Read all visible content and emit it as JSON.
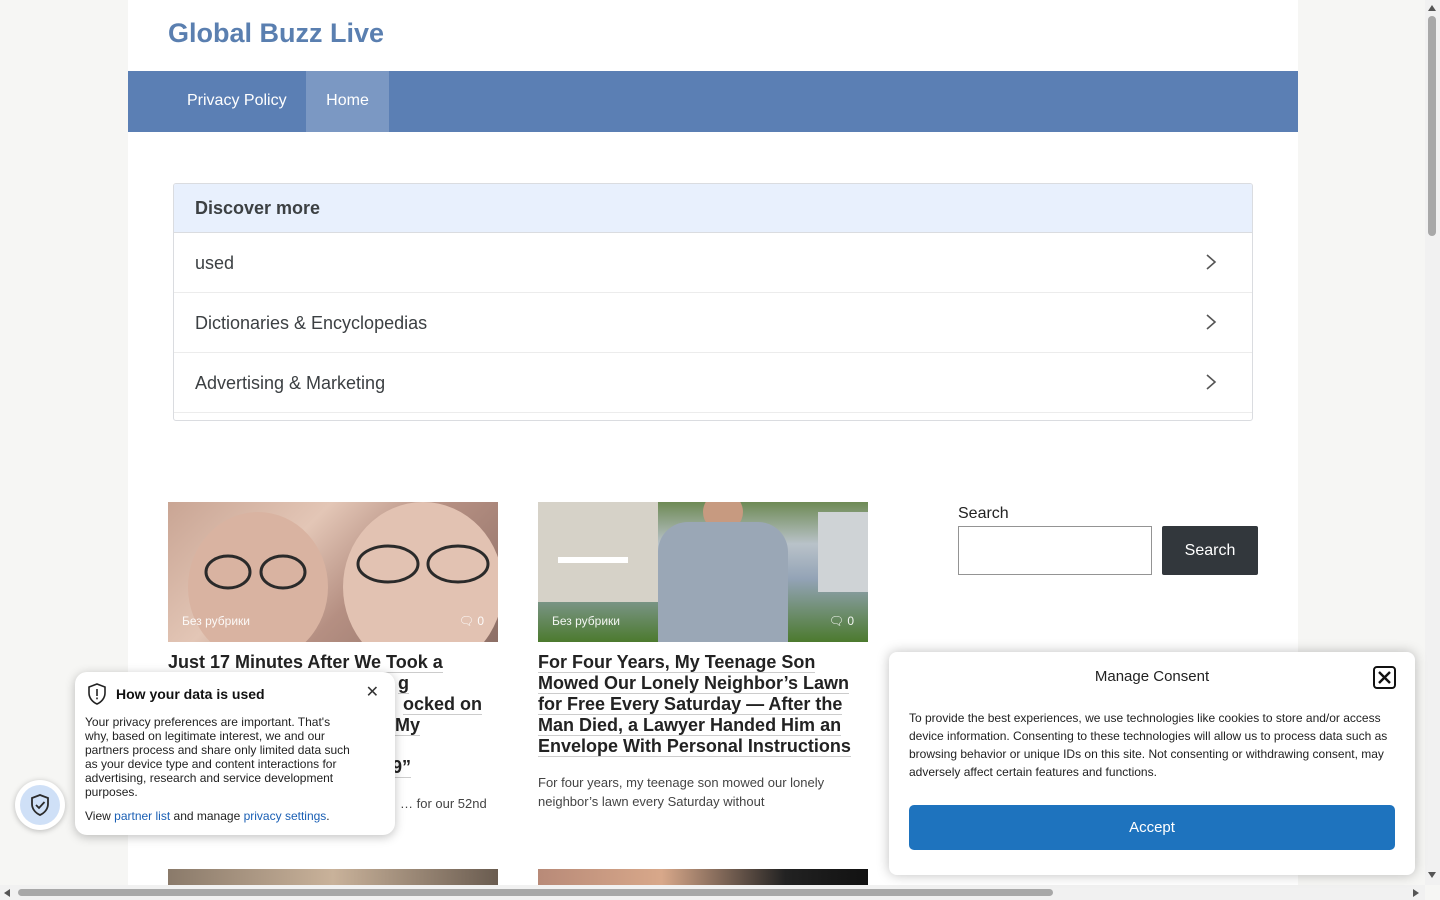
{
  "site": {
    "title": "Global Buzz Live"
  },
  "nav": {
    "items": [
      {
        "label": "Privacy Policy"
      },
      {
        "label": "Home"
      }
    ]
  },
  "discover": {
    "heading": "Discover more",
    "items": [
      {
        "label": "used"
      },
      {
        "label": "Dictionaries & Encyclopedias"
      },
      {
        "label": "Advertising & Marketing"
      }
    ]
  },
  "posts": [
    {
      "category": "Без рубрики",
      "comments": "0",
      "title": "Just 17 Minutes After We Took a … g … ocked on … My Husband … 9”",
      "excerpt": "… for our 52nd"
    },
    {
      "category": "Без рубрики",
      "comments": "0",
      "title": "For Four Years, My Teenage Son Mowed Our Lonely Neighbor’s Lawn for Free Every Saturday — After the Man Died, a Lawyer Handed Him an Envelope With Personal Instructions",
      "excerpt": "For four years, my teenage son mowed our lonely neighbor’s lawn every Saturday without"
    }
  ],
  "post1_title_lines": [
    "Just 17 Minutes After We Took a",
    "g",
    "ocked on",
    "My Husband",
    "9”"
  ],
  "search": {
    "label": "Search",
    "button": "Search",
    "value": ""
  },
  "privacy_popup": {
    "title": "How your data is used",
    "body": "Your privacy preferences are important. That's why, based on legitimate interest, we and our partners process and share only limited data such as your device type and content interactions for advertising, research and service development purposes.",
    "view_prefix": "View",
    "partner_link": "partner list",
    "middle": "and manage",
    "settings_link": "privacy settings",
    "suffix": "."
  },
  "consent": {
    "title": "Manage Consent",
    "text": "To provide the best experiences, we use technologies like cookies to store and/or access device information. Consenting to these technologies will allow us to process data such as browsing behavior or unique IDs on this site. Not consenting or withdrawing consent, may adversely affect certain features and functions.",
    "accept": "Accept"
  },
  "colors": {
    "nav": "#5b7fb4",
    "nav_active": "#7b98c3",
    "title": "#5a7fb0",
    "accept": "#1e73be",
    "search_button": "#32373c"
  },
  "icons": [
    "chevron-right-icon",
    "comment-icon",
    "shield-alert-icon",
    "close-icon",
    "shield-check-icon"
  ]
}
